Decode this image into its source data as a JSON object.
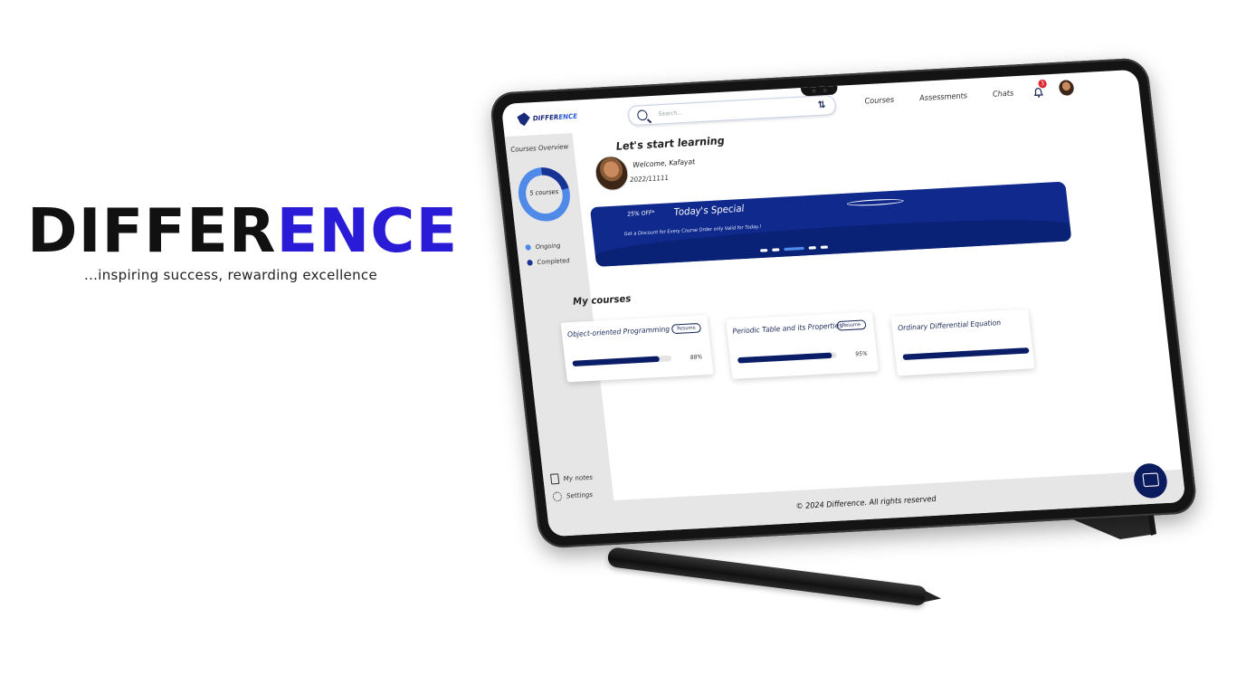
{
  "brand": {
    "title_a": "DIFFER",
    "title_b": "ENCE",
    "tagline": "...inspiring success, rewarding excellence",
    "colors": {
      "dark": "#111111",
      "accent": "#2a1bd6"
    }
  },
  "app": {
    "logo_a": "DIFFER",
    "logo_b": "ENCE",
    "search_placeholder": "Search...",
    "nav": [
      "Courses",
      "Assessments",
      "Chats"
    ],
    "notification_count": "3",
    "sidebar": {
      "title": "Courses Overview",
      "donut_label": "5 courses",
      "legend": [
        {
          "label": "Ongoing",
          "color": "#4f8ae9"
        },
        {
          "label": "Completed",
          "color": "#173394"
        }
      ],
      "bottom": [
        {
          "label": "My notes",
          "icon": "notes-icon"
        },
        {
          "label": "Settings",
          "icon": "gear-icon"
        }
      ]
    },
    "main": {
      "title": "Let's start learning",
      "welcome": "Welcome, Kafayat",
      "reg_no": "2022/11111",
      "banner": {
        "badge": "25% OFF*",
        "title": "Today's Special",
        "subtitle": "Get a Discount for Every Course Order only Valid for Today.!"
      },
      "section_title": "My courses",
      "courses": [
        {
          "title": "Object-oriented Programming",
          "resume": "Resume",
          "progress_pct": 88,
          "progress_label": "88%"
        },
        {
          "title": "Periodic Table and its Properties",
          "resume": "Resume",
          "progress_pct": 95,
          "progress_label": "95%"
        },
        {
          "title": "Ordinary Differential Equation",
          "resume": "",
          "progress_pct": 100,
          "progress_label": ""
        }
      ]
    },
    "footer": "© 2024 Difference. All rights reserved"
  }
}
